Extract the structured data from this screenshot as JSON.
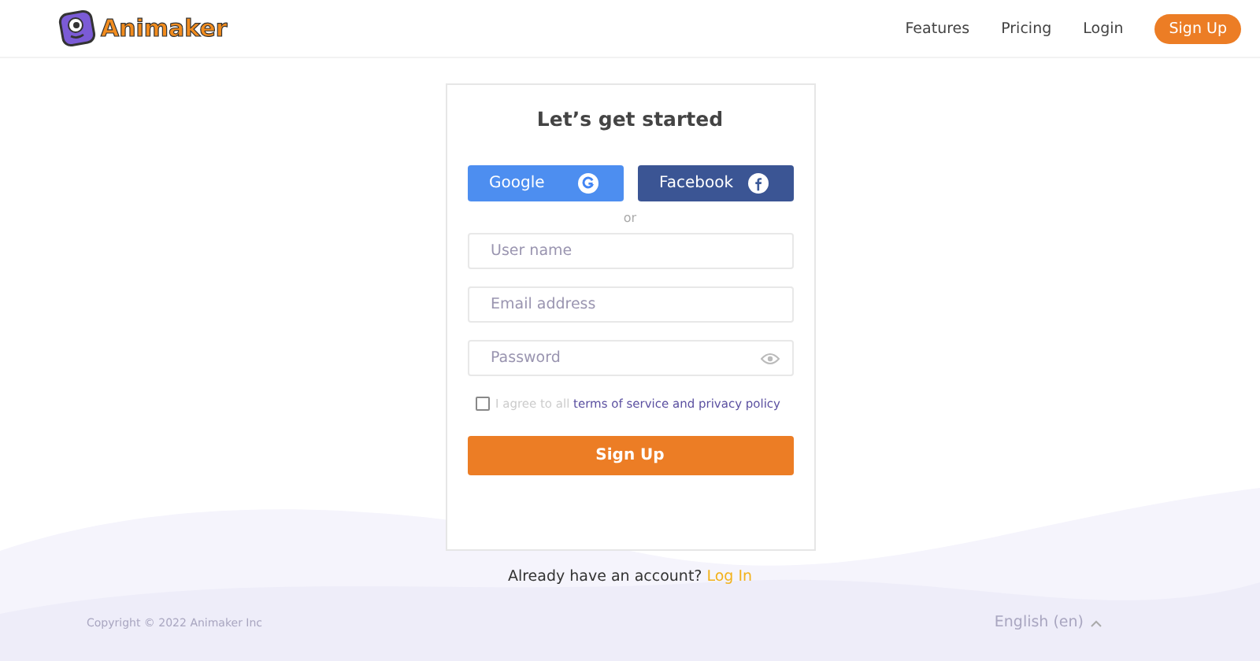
{
  "header": {
    "logo": "Animaker",
    "nav": [
      {
        "label": "Features",
        "kind": "link"
      },
      {
        "label": "Pricing",
        "kind": "link"
      },
      {
        "label": "Login",
        "kind": "link"
      },
      {
        "label": "Sign Up",
        "kind": "button"
      }
    ]
  },
  "card": {
    "title": "Let’s get started",
    "social": [
      {
        "label": "Google",
        "kind": "google"
      },
      {
        "label": "Facebook",
        "kind": "facebook"
      }
    ],
    "divider": "or",
    "fields": [
      {
        "placeholder": "User name",
        "kind": "text"
      },
      {
        "placeholder": "Email address",
        "kind": "text"
      },
      {
        "placeholder": "Password",
        "kind": "password"
      }
    ],
    "agree": {
      "checked": false,
      "text": "I agree to all",
      "link": "terms of service and privacy policy"
    },
    "submit": "Sign Up"
  },
  "login_prompt": {
    "text": "Already have an account?",
    "link": "Log In"
  },
  "footer": {
    "copyright": "Copyright © 2022 Animaker Inc",
    "language": "English (en)"
  }
}
